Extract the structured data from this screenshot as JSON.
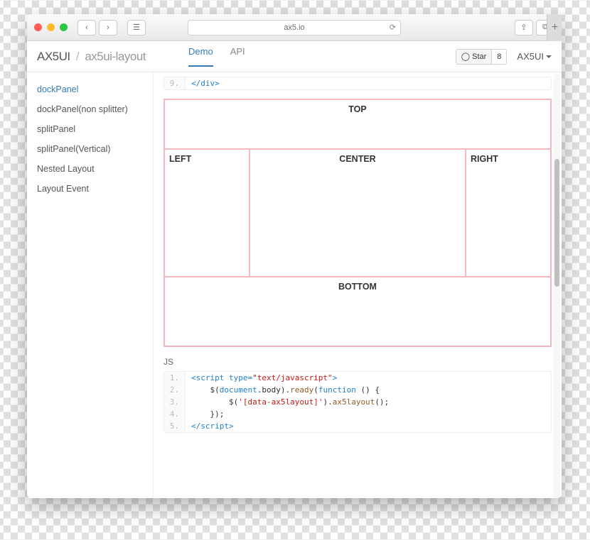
{
  "browser": {
    "address": "ax5.io",
    "new_tab": "+"
  },
  "header": {
    "brand": "AX5UI",
    "slash": "/",
    "subtitle": "ax5ui-layout",
    "tabs": {
      "demo": "Demo",
      "api": "API"
    },
    "github": {
      "star": "Star",
      "count": "8"
    },
    "dropdown": "AX5UI"
  },
  "sidebar": {
    "items": [
      "dockPanel",
      "dockPanel(non splitter)",
      "splitPanel",
      "splitPanel(Vertical)",
      "Nested Layout",
      "Layout Event"
    ]
  },
  "code_top": {
    "lines": [
      "9."
    ],
    "content": [
      "</div>"
    ]
  },
  "demo": {
    "top": "TOP",
    "left": "LEFT",
    "center": "CENTER",
    "right": "RIGHT",
    "bottom": "BOTTOM"
  },
  "js_label": "JS",
  "code_js": {
    "lines": [
      "1.",
      "2.",
      "3.",
      "4.",
      "5."
    ],
    "l1a": "<script type=",
    "l1b": "\"text/javascript\"",
    "l1c": ">",
    "l2a": "    $(",
    "l2b": "document",
    "l2c": ".body).",
    "l2d": "ready",
    "l2e": "(",
    "l2f": "function ",
    "l2g": "() {",
    "l3a": "        $(",
    "l3b": "'[data-ax5layout]'",
    "l3c": ").",
    "l3d": "ax5layout",
    "l3e": "();",
    "l4": "    });",
    "l5a": "</",
    "l5b": "script",
    "l5c": ">"
  }
}
